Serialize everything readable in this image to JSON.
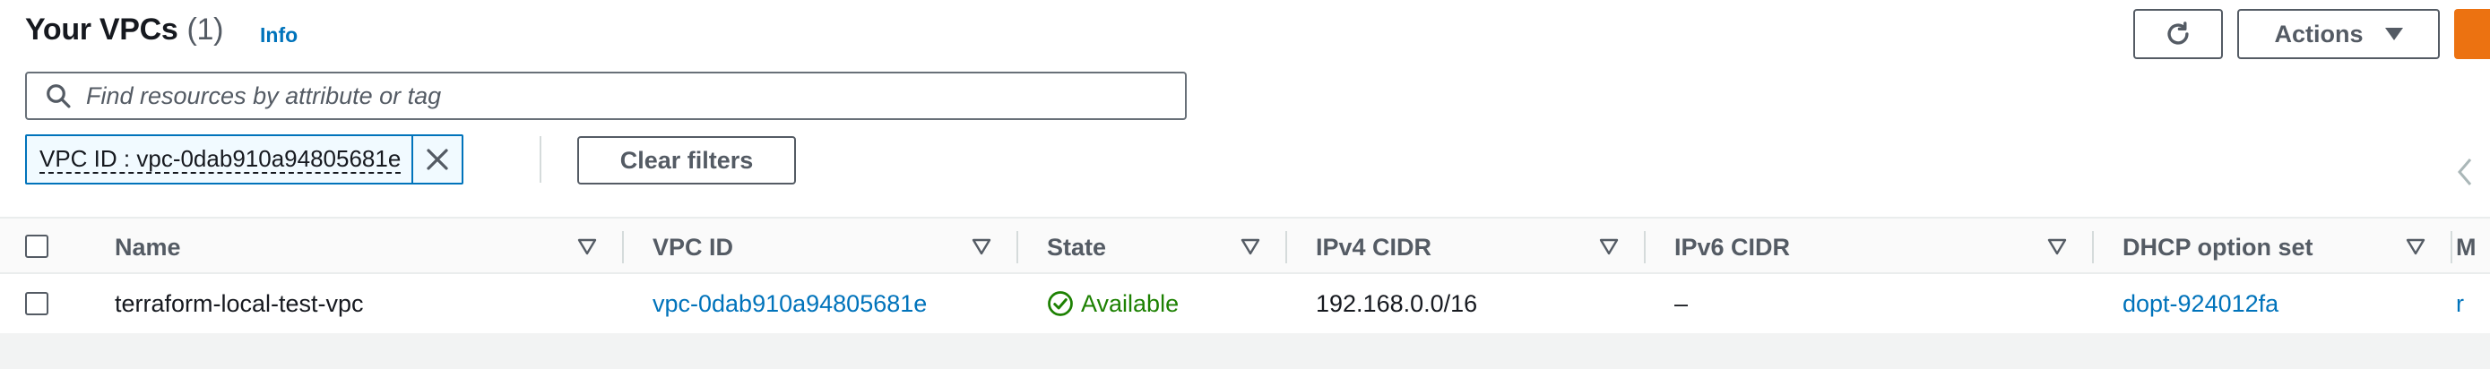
{
  "header": {
    "title": "Your VPCs",
    "count": "(1)",
    "info": "Info",
    "actions_label": "Actions"
  },
  "search": {
    "placeholder": "Find resources by attribute or tag"
  },
  "filter": {
    "token": "VPC ID : vpc-0dab910a94805681e",
    "clear_label": "Clear filters"
  },
  "table": {
    "columns": [
      "Name",
      "VPC ID",
      "State",
      "IPv4 CIDR",
      "IPv6 CIDR",
      "DHCP option set",
      "M"
    ],
    "rows": [
      {
        "name": "terraform-local-test-vpc",
        "vpc_id": "vpc-0dab910a94805681e",
        "state": "Available",
        "ipv4": "192.168.0.0/16",
        "ipv6": "–",
        "dhcp": "dopt-924012fa",
        "main_rt": "r"
      }
    ]
  },
  "colors": {
    "link": "#0073bb",
    "success": "#1d8102",
    "primary_button": "#ec7211"
  },
  "icons": [
    "refresh-icon",
    "caret-down-icon",
    "search-icon",
    "close-icon",
    "sort-icon",
    "status-check-icon",
    "chevron-left-icon"
  ]
}
